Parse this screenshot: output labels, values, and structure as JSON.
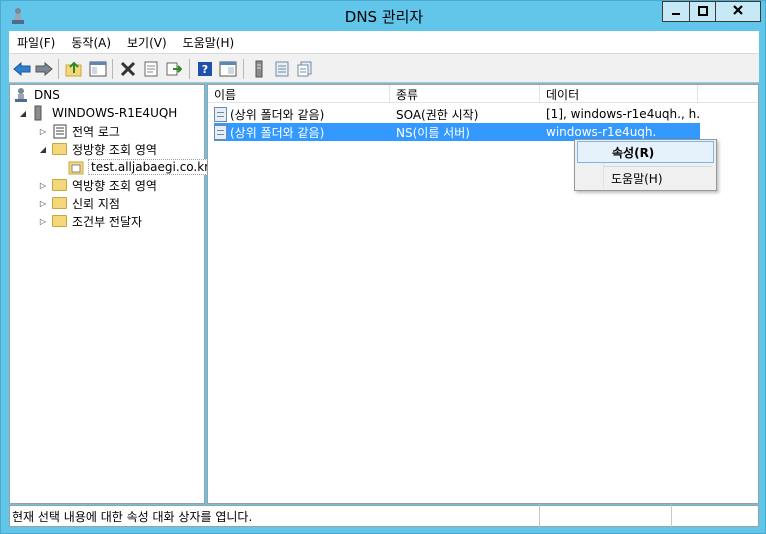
{
  "window": {
    "title": "DNS 관리자"
  },
  "menubar": {
    "items": [
      "파일(F)",
      "동작(A)",
      "보기(V)",
      "도움말(H)"
    ]
  },
  "toolbar": {
    "buttons": [
      "back-icon",
      "forward-icon",
      "up-folder-icon",
      "show-hide-tree-icon",
      "delete-icon",
      "properties-icon",
      "export-icon",
      "help-icon",
      "console-icon",
      "server-icon",
      "list-icon",
      "records-icon"
    ]
  },
  "tree": {
    "root": "DNS",
    "server": "WINDOWS-R1E4UQH",
    "items": [
      {
        "label": "전역 로그"
      },
      {
        "label": "정방향 조회 영역"
      },
      {
        "label": "test.alljabaegi.co.kr"
      },
      {
        "label": "역방향 조회 영역"
      },
      {
        "label": "신뢰 지점"
      },
      {
        "label": "조건부 전달자"
      }
    ]
  },
  "list": {
    "columns": [
      "이름",
      "종류",
      "데이터"
    ],
    "rows": [
      {
        "name": "(상위 폴더와 같음)",
        "type": "SOA(권한 시작)",
        "data": "[1], windows-r1e4uqh., h..."
      },
      {
        "name": "(상위 폴더와 같음)",
        "type": "NS(이름 서버)",
        "data": "windows-r1e4uqh."
      }
    ]
  },
  "context_menu": {
    "items": [
      "속성(R)",
      "도움말(H)"
    ]
  },
  "statusbar": {
    "text": "현재 선택 내용에 대한 속성 대화 상자를 엽니다."
  },
  "colors": {
    "frame": "#61c6ea",
    "selection": "#3399ff",
    "menu_highlight": "#e5f1fb"
  }
}
